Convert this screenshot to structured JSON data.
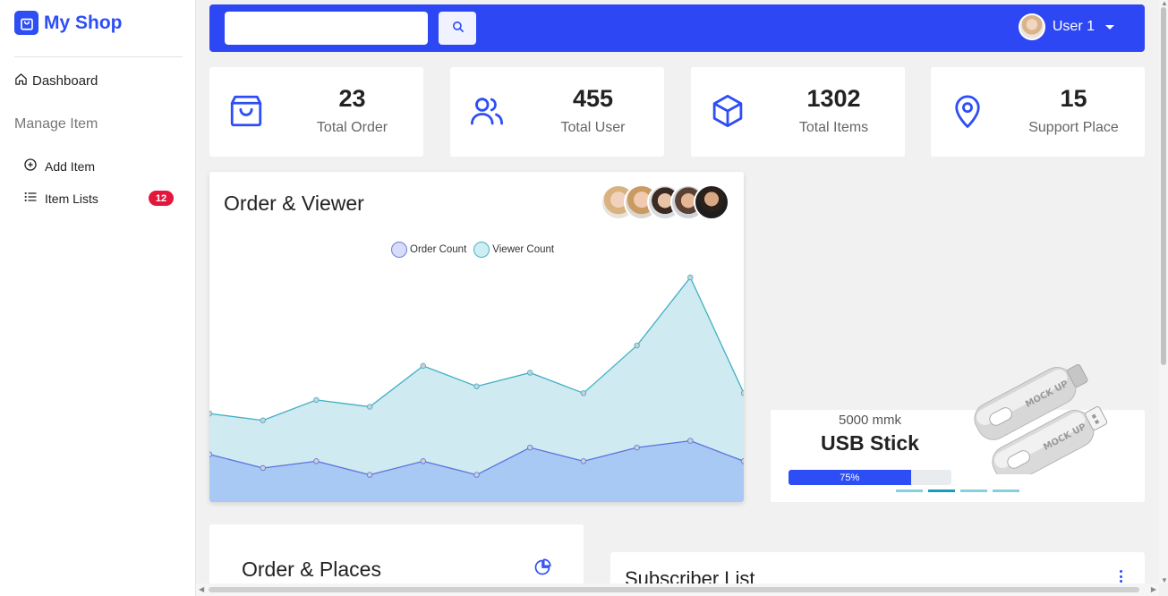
{
  "app": {
    "title": "My Shop"
  },
  "sidebar": {
    "dashboard_label": "Dashboard",
    "section_label": "Manage Item",
    "items": [
      {
        "label": "Add Item",
        "icon": "plus-circle-icon"
      },
      {
        "label": "Item Lists",
        "icon": "list-icon",
        "badge": "12"
      }
    ]
  },
  "topbar": {
    "search_value": "",
    "search_placeholder": "",
    "user_label": "User 1"
  },
  "stats": [
    {
      "value": "23",
      "label": "Total Order",
      "icon": "shopping-bag-icon"
    },
    {
      "value": "455",
      "label": "Total User",
      "icon": "users-icon"
    },
    {
      "value": "1302",
      "label": "Total Items",
      "icon": "box-icon"
    },
    {
      "value": "15",
      "label": "Support Place",
      "icon": "map-pin-icon"
    }
  ],
  "order_viewer": {
    "title": "Order & Viewer",
    "legend": [
      "Order Count",
      "Viewer Count"
    ]
  },
  "chart_data": {
    "type": "area",
    "title": "",
    "series": [
      {
        "name": "Order Count",
        "values": [
          7,
          5,
          6,
          4,
          6,
          4,
          8,
          6,
          8,
          9,
          6
        ],
        "color": "#5b73e0"
      },
      {
        "name": "Viewer Count",
        "values": [
          13,
          12,
          15,
          14,
          20,
          17,
          19,
          16,
          23,
          33,
          16
        ],
        "color": "#3fb0c4"
      }
    ],
    "ylim": [
      0,
      33
    ]
  },
  "product": {
    "price": "5000 mmk",
    "name": "USB Stick",
    "progress": 0.75,
    "progress_label": "75%",
    "art_text": "MOCK UP"
  },
  "places": {
    "title": "Order & Places"
  },
  "subscribers": {
    "title": "Subscriber List"
  },
  "colors": {
    "primary": "#2d4ef5",
    "topbar": "#2d47f4",
    "badge": "#e3163b"
  }
}
